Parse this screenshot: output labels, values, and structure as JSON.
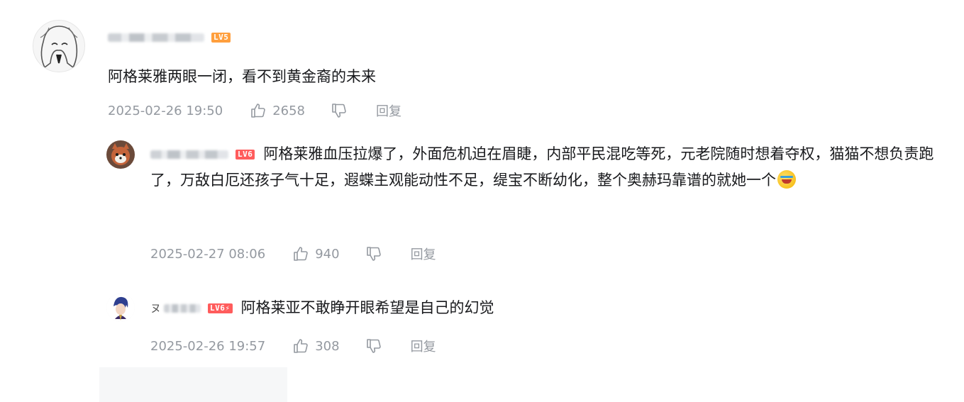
{
  "comment": {
    "level": "LV5",
    "content": "阿格莱雅两眼一闭，看不到黄金裔的未来",
    "time": "2025-02-26 19:50",
    "likes": "2658",
    "reply_label": "回复"
  },
  "replies": [
    {
      "level": "LV6",
      "content": "阿格莱雅血压拉爆了，外面危机迫在眉睫，内部平民混吃等死，元老院随时想着夺权，猫猫不想负责跑了，万敌白厄还孩子气十足，遐蝶主观能动性不足，缇宝不断幼化，整个奥赫玛靠谱的就她一个",
      "emoji": "crying-laugh-emoji",
      "time": "2025-02-27 08:06",
      "likes": "940",
      "reply_label": "回复"
    },
    {
      "name_prefix": "ヌ",
      "level": "LV6⚡",
      "content": "阿格莱亚不敢睁开眼希望是自己的幻觉",
      "time": "2025-02-26 19:57",
      "likes": "308",
      "reply_label": "回复"
    }
  ],
  "icons": {
    "like": "thumbs-up-icon",
    "dislike": "thumbs-down-icon"
  },
  "colors": {
    "text": "#18191c",
    "meta": "#9499a0",
    "lv5": "#ff9f3d",
    "lv6": "#ff5c5c"
  }
}
